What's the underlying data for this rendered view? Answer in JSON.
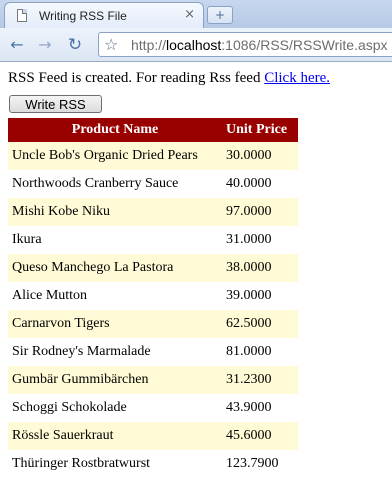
{
  "browser": {
    "tab_title": "Writing RSS File",
    "tab_close": "×",
    "new_tab": "+",
    "url_prefix": "http://",
    "url_host": "localhost",
    "url_rest": ":1086/RSS/RSSWrite.aspx"
  },
  "page": {
    "message": "RSS Feed is created. For reading Rss feed ",
    "link_text": "Click here.",
    "button_label": "Write RSS",
    "table": {
      "headers": [
        "Product Name",
        "Unit Price"
      ],
      "rows": [
        [
          "Uncle Bob's Organic Dried Pears",
          "30.0000"
        ],
        [
          "Northwoods Cranberry Sauce",
          "40.0000"
        ],
        [
          "Mishi Kobe Niku",
          "97.0000"
        ],
        [
          "Ikura",
          "31.0000"
        ],
        [
          "Queso Manchego La Pastora",
          "38.0000"
        ],
        [
          "Alice Mutton",
          "39.0000"
        ],
        [
          "Carnarvon Tigers",
          "62.5000"
        ],
        [
          "Sir Rodney's Marmalade",
          "81.0000"
        ],
        [
          "Gumbär Gummibärchen",
          "31.2300"
        ],
        [
          "Schoggi Schokolade",
          "43.9000"
        ],
        [
          "Rössle Sauerkraut",
          "45.6000"
        ],
        [
          "Thüringer Rostbratwurst",
          "123.7900"
        ]
      ]
    }
  },
  "colors": {
    "header_bg": "#990000",
    "alt_row_bg": "#fffbd6"
  }
}
